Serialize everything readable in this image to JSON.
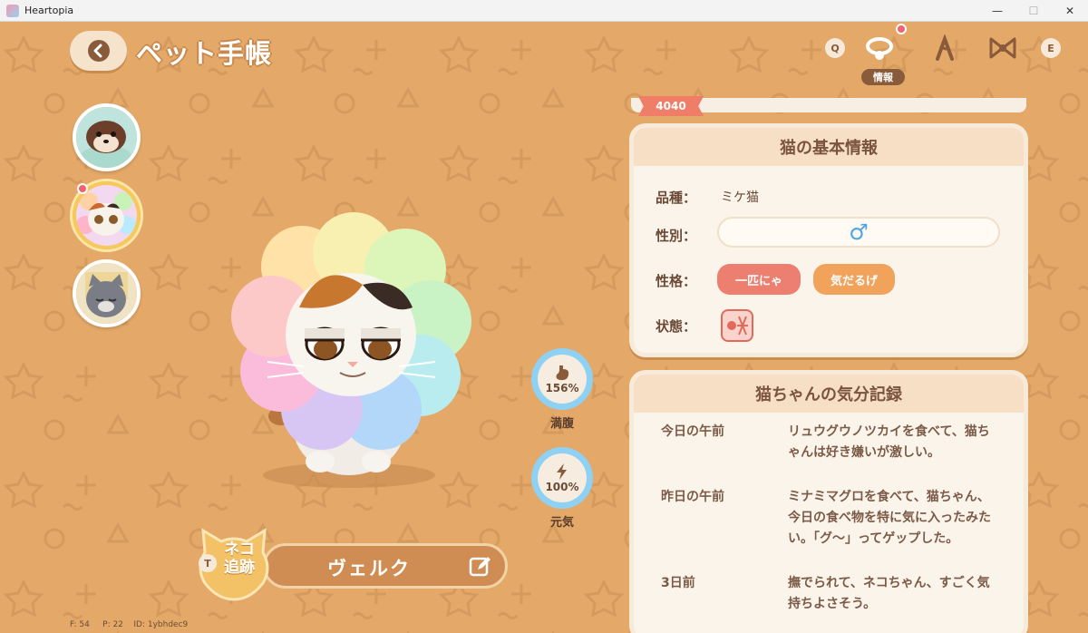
{
  "window": {
    "title": "Heartopia",
    "minimize": "—",
    "maximize": "☐",
    "close": "✕"
  },
  "header": {
    "title": "ペット手帳",
    "key_left": "Q",
    "key_right": "E",
    "active_tab_label": "情報",
    "tabs": [
      "collar-icon",
      "scratch-icon",
      "bow-icon"
    ]
  },
  "pets": [
    {
      "name": "shiba-dog",
      "selected": false
    },
    {
      "name": "calico-cat",
      "selected": true,
      "notification": true
    },
    {
      "name": "gray-cat",
      "selected": false
    }
  ],
  "stats": {
    "fullness": {
      "value": "156%",
      "label": "満腹"
    },
    "energy": {
      "value": "100%",
      "label": "元気"
    }
  },
  "nameplate": {
    "track_label_line1": "ネコ",
    "track_label_line2": "追跡",
    "track_key": "T",
    "pet_name": "ヴェルク"
  },
  "debug": {
    "f": "F: 54",
    "p": "P: 22",
    "id": "ID: 1ybhdec9"
  },
  "level": "4040",
  "basic_info": {
    "title": "猫の基本情報",
    "breed_label": "品種：",
    "breed": "ミケ猫",
    "gender_label": "性別：",
    "gender": "♂",
    "personality_label": "性格：",
    "personality": [
      "一匹にゃ",
      "気だるげ"
    ],
    "status_label": "状態："
  },
  "mood_log": {
    "title": "猫ちゃんの気分記録",
    "entries": [
      {
        "day": "今日の午前",
        "text": "リュウグウノツカイを食べて、猫ちゃんは好き嫌いが激しい。"
      },
      {
        "day": "昨日の午前",
        "text": "ミナミマグロを食べて、猫ちゃん、今日の食べ物を特に気に入ったみたい。「グ〜」ってゲップした。"
      },
      {
        "day": "3日前",
        "text": "撫でられて、ネコちゃん、すごく気持ちよさそう。"
      }
    ]
  },
  "colors": {
    "background": "#e4a868",
    "panel": "#fbf4ea",
    "accent_blue": "#8ed1f2",
    "tag_red": "#ec7f70",
    "tag_orange": "#f1a35c"
  }
}
